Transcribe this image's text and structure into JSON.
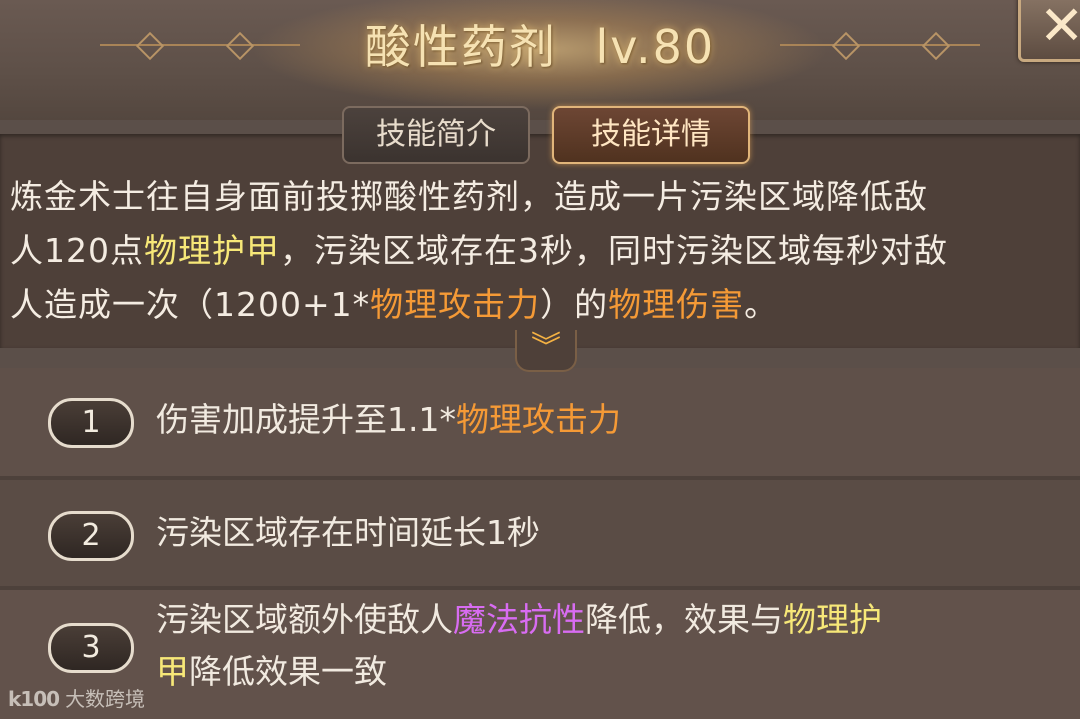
{
  "skill": {
    "name": "酸性药剂",
    "level": "lv.80"
  },
  "tabs": {
    "intro": "技能简介",
    "details": "技能详情"
  },
  "close_icon": "close-icon",
  "description": {
    "l1": "炼金术士往自身面前投掷酸性药剂，造成一片污染区域降低敌",
    "l2a": "人120点",
    "l2b": "物理护甲",
    "l2c": "，污染区域存在3秒，同时污染区域每秒对敌",
    "l3a": "人造成一次（1200+1*",
    "l3b": "物理攻击力",
    "l3c": "）的",
    "l3d": "物理伤害",
    "l3e": "。"
  },
  "upgrades": [
    {
      "num": "1",
      "text_a": "伤害加成提升至1.1*",
      "text_b": "物理攻击力"
    },
    {
      "num": "2",
      "text_a": "污染区域存在时间延长1秒"
    },
    {
      "num": "3",
      "text_a": "污染区域额外使敌人",
      "text_b": "魔法抗性",
      "text_c": "降低，效果与",
      "text_d": "物理护",
      "text_e": "甲",
      "text_f": "降低效果一致"
    }
  ],
  "watermark": {
    "logo": "k100",
    "text": "大数跨境"
  },
  "colors": {
    "keyword_yellow": "#f7e878",
    "keyword_orange": "#f59a36",
    "keyword_purple": "#d86cf2",
    "active_tab_border": "#e1b57a"
  }
}
